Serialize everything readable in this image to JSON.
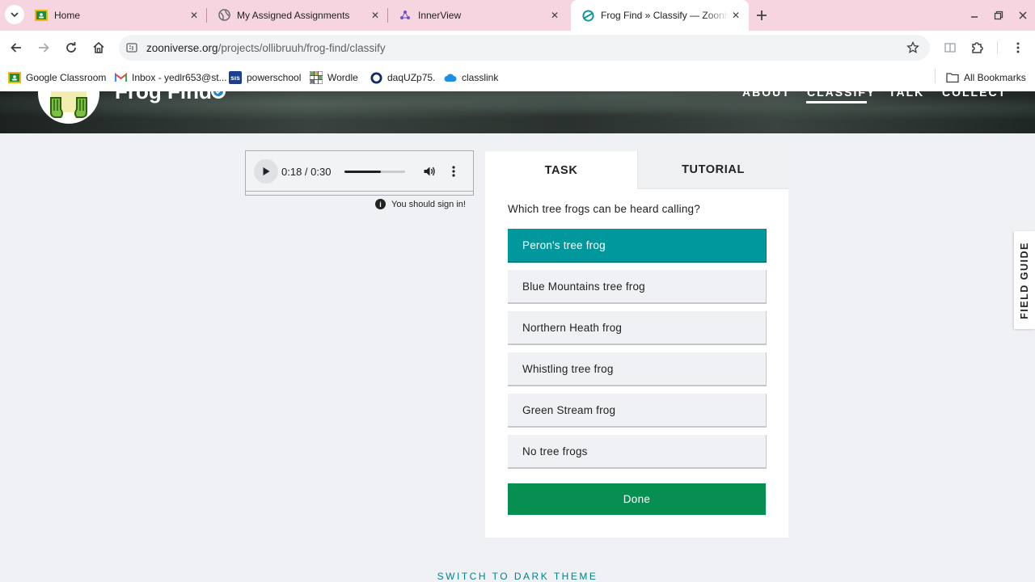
{
  "browser": {
    "tabs": [
      {
        "title": "Home",
        "icon": "google-classroom-icon",
        "active": false
      },
      {
        "title": "My Assigned Assignments",
        "icon": "globe-icon",
        "active": false
      },
      {
        "title": "InnerView",
        "icon": "innerview-icon",
        "active": false
      },
      {
        "title": "Frog Find » Classify — Zooniverse",
        "icon": "zooniverse-icon",
        "active": true
      }
    ],
    "url_host": "zooniverse.org",
    "url_path": "/projects/ollibruuh/frog-find/classify",
    "bookmarks": [
      {
        "label": "Google Classroom",
        "icon": "google-classroom-icon"
      },
      {
        "label": "Inbox - yedlr653@st...",
        "icon": "gmail-icon"
      },
      {
        "label": "powerschool",
        "icon": "powerschool-icon"
      },
      {
        "label": "Wordle",
        "icon": "wordle-icon"
      },
      {
        "label": "daqUZp75.",
        "icon": "circle-icon"
      },
      {
        "label": "classlink",
        "icon": "classlink-icon"
      }
    ],
    "all_bookmarks": "All Bookmarks"
  },
  "project": {
    "title": "Frog Find",
    "nav": [
      "ABOUT",
      "CLASSIFY",
      "TALK",
      "COLLECT"
    ],
    "active_nav": "CLASSIFY"
  },
  "audio": {
    "time": "0:18 / 0:30",
    "progress": 0.6
  },
  "signin_notice": "You should sign in!",
  "task_panel": {
    "tabs": [
      "TASK",
      "TUTORIAL"
    ],
    "question": "Which tree frogs can be heard calling?",
    "answers": [
      {
        "label": "Peron's tree frog",
        "selected": true
      },
      {
        "label": "Blue Mountains tree frog",
        "selected": false
      },
      {
        "label": "Northern Heath frog",
        "selected": false
      },
      {
        "label": "Whistling tree frog",
        "selected": false
      },
      {
        "label": "Green Stream frog",
        "selected": false
      },
      {
        "label": "No tree frogs",
        "selected": false
      }
    ],
    "done_label": "Done"
  },
  "field_guide_label": "FIELD GUIDE",
  "footer": {
    "dark_theme_label": "SWITCH TO DARK THEME"
  },
  "colors": {
    "selected_answer": "#00979d",
    "done_button": "#078f52",
    "tab_strip": "#f6d4e0",
    "link": "#00828a"
  }
}
